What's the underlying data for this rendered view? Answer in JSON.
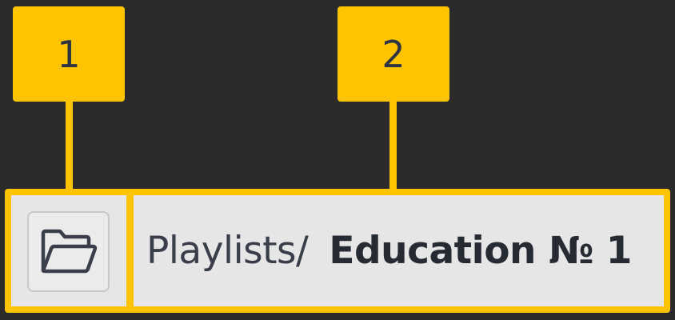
{
  "theme": {
    "accent": "#ffc400",
    "background": "#2b2b2b",
    "bar_background": "#e6e6e6"
  },
  "callouts": [
    {
      "number": "1"
    },
    {
      "number": "2"
    }
  ],
  "toolbar": {
    "folder_icon": "folder-open-icon"
  },
  "breadcrumb": {
    "parent": "Playlists/",
    "current": "Education № 1"
  }
}
